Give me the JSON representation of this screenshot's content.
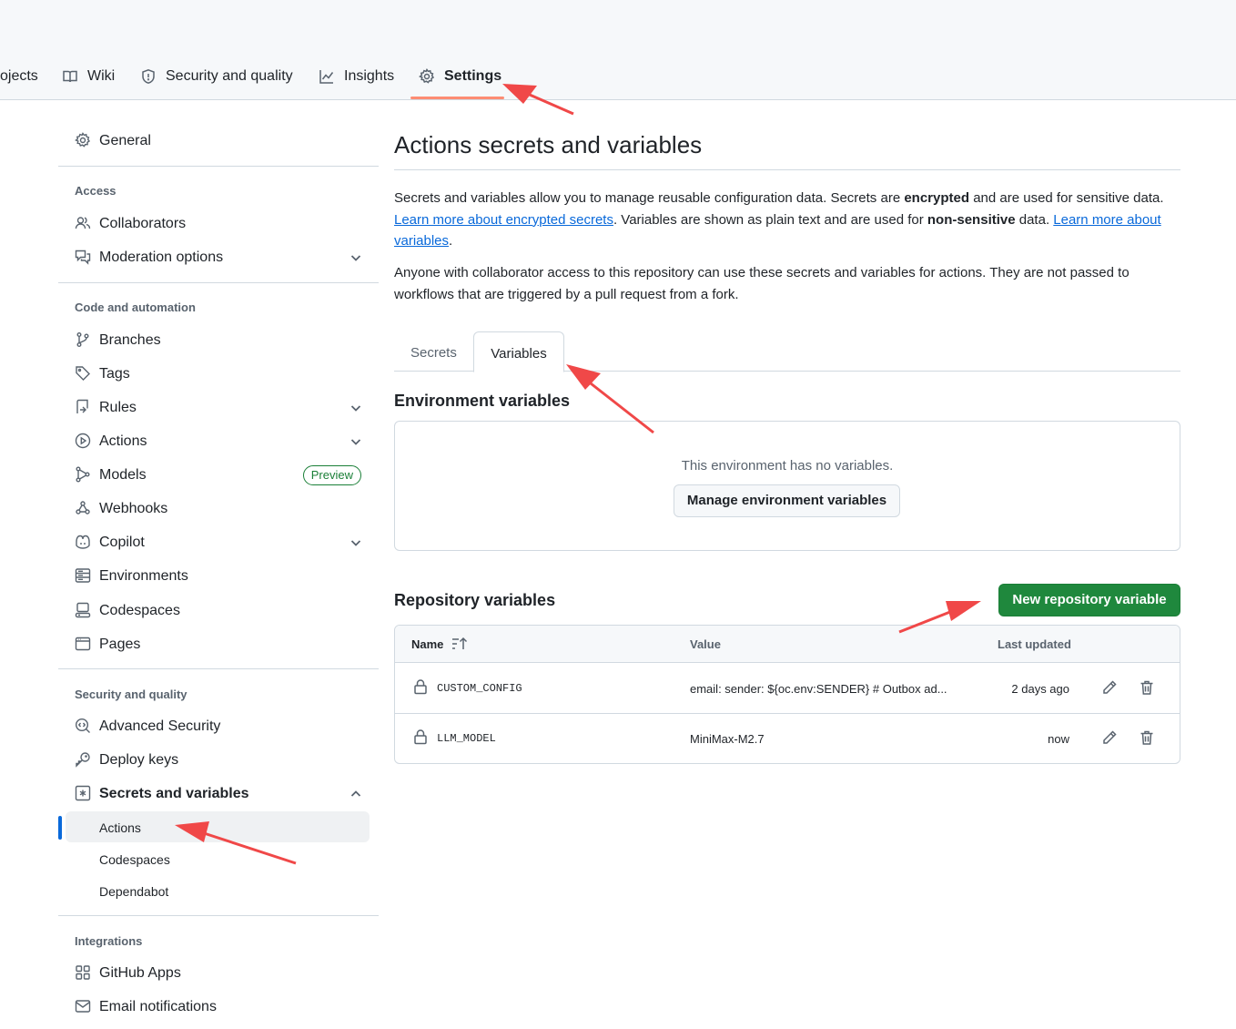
{
  "nav": {
    "tabs": [
      {
        "label": "ojects",
        "icon": "table-icon"
      },
      {
        "label": "Wiki",
        "icon": "book-icon"
      },
      {
        "label": "Security and quality",
        "icon": "shield-icon"
      },
      {
        "label": "Insights",
        "icon": "graph-icon"
      },
      {
        "label": "Settings",
        "icon": "gear-icon",
        "selected": true
      }
    ]
  },
  "sidebar": {
    "general": "General",
    "access_heading": "Access",
    "access": [
      "Collaborators",
      "Moderation options"
    ],
    "code_heading": "Code and automation",
    "code": [
      "Branches",
      "Tags",
      "Rules",
      "Actions",
      "Models",
      "Webhooks",
      "Copilot",
      "Environments",
      "Codespaces",
      "Pages"
    ],
    "preview_badge": "Preview",
    "security_heading": "Security and quality",
    "security": [
      "Advanced Security",
      "Deploy keys",
      "Secrets and variables"
    ],
    "secrets_sub": [
      "Actions",
      "Codespaces",
      "Dependabot"
    ],
    "integrations_heading": "Integrations",
    "integrations": [
      "GitHub Apps",
      "Email notifications"
    ]
  },
  "main": {
    "title": "Actions secrets and variables",
    "p1": {
      "a": "Secrets and variables allow you to manage reusable configuration data. Secrets are ",
      "b": "encrypted",
      "c": " and are used for sensitive data. ",
      "link1": "Learn more about encrypted secrets",
      "d": ". Variables are shown as plain text and are used for ",
      "e": "non-sensitive",
      "f": " data. ",
      "link2": "Learn more about variables",
      "g": "."
    },
    "p2": "Anyone with collaborator access to this repository can use these secrets and variables for actions. They are not passed to workflows that are triggered by a pull request from a fork.",
    "tabs": [
      "Secrets",
      "Variables"
    ],
    "env_heading": "Environment variables",
    "env_empty": "This environment has no variables.",
    "env_button": "Manage environment variables",
    "repo_heading": "Repository variables",
    "new_button": "New repository variable",
    "table": {
      "headers": {
        "name": "Name",
        "value": "Value",
        "updated": "Last updated"
      },
      "rows": [
        {
          "name": "CUSTOM_CONFIG",
          "value": "email: sender: ${oc.env:SENDER} # Outbox ad...",
          "updated": "2 days ago"
        },
        {
          "name": "LLM_MODEL",
          "value": "MiniMax-M2.7",
          "updated": "now"
        }
      ]
    }
  },
  "colors": {
    "accent": "#0969da",
    "primary_button": "#1f883d",
    "annotation_arrow": "#f04848",
    "tab_underline": "#fd8c73"
  }
}
